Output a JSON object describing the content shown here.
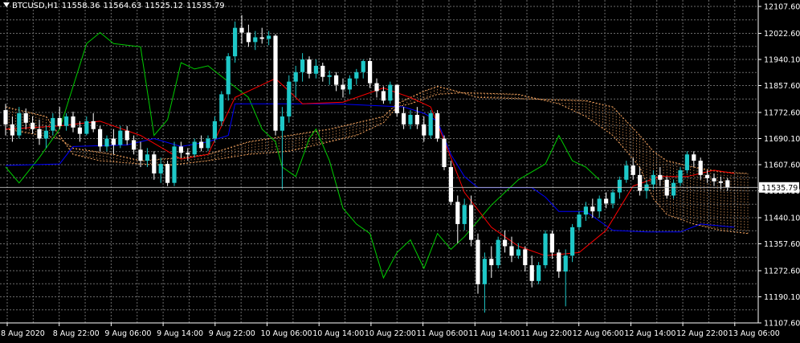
{
  "header": {
    "symbol": "BTCUSD,H1",
    "open": "11558.36",
    "high": "11564.63",
    "low": "11525.12",
    "close": "11535.79"
  },
  "price_label": "11535.79",
  "colors": {
    "background": "#000000",
    "grid": "#6b6b6b",
    "axis_text": "#ffffff",
    "bull": "#1ec8c8",
    "bear": "#ffffff",
    "tenkan": "#ff0000",
    "kijun": "#0000ff",
    "chikou": "#00cc00",
    "cloud": "#f4a460",
    "price_box": "#ffffff"
  },
  "chart_data": {
    "type": "candlestick",
    "instrument": "BTCUSD",
    "timeframe": "H1",
    "ylim": [
      11107.6,
      12107.6
    ],
    "y_ticks": [
      "12107.60",
      "12022.60",
      "11940.10",
      "11857.60",
      "11772.60",
      "11690.10",
      "11607.60",
      "11525.10",
      "11440.10",
      "11357.60",
      "11272.60",
      "11190.10",
      "11107.60"
    ],
    "x_ticks": [
      "8 Aug 2020",
      "8 Aug 22:00",
      "9 Aug 06:00",
      "9 Aug 14:00",
      "9 Aug 22:00",
      "10 Aug 06:00",
      "10 Aug 14:00",
      "10 Aug 22:00",
      "11 Aug 06:00",
      "11 Aug 14:00",
      "11 Aug 22:00",
      "12 Aug 06:00",
      "12 Aug 14:00",
      "12 Aug 22:00",
      "13 Aug 06:00"
    ],
    "grid": true,
    "candles": [
      [
        11780,
        11800,
        11700,
        11735
      ],
      [
        11735,
        11760,
        11680,
        11700
      ],
      [
        11700,
        11790,
        11690,
        11770
      ],
      [
        11770,
        11785,
        11720,
        11740
      ],
      [
        11740,
        11760,
        11705,
        11720
      ],
      [
        11720,
        11750,
        11670,
        11690
      ],
      [
        11690,
        11730,
        11660,
        11715
      ],
      [
        11715,
        11770,
        11700,
        11755
      ],
      [
        11755,
        11790,
        11720,
        11730
      ],
      [
        11730,
        11770,
        11715,
        11760
      ],
      [
        11760,
        11775,
        11710,
        11725
      ],
      [
        11725,
        11745,
        11680,
        11705
      ],
      [
        11705,
        11760,
        11700,
        11745
      ],
      [
        11745,
        11770,
        11710,
        11720
      ],
      [
        11720,
        11730,
        11650,
        11665
      ],
      [
        11665,
        11700,
        11650,
        11690
      ],
      [
        11690,
        11720,
        11640,
        11670
      ],
      [
        11670,
        11730,
        11660,
        11715
      ],
      [
        11715,
        11730,
        11670,
        11685
      ],
      [
        11685,
        11700,
        11640,
        11655
      ],
      [
        11655,
        11680,
        11600,
        11620
      ],
      [
        11620,
        11660,
        11600,
        11640
      ],
      [
        11640,
        11650,
        11560,
        11580
      ],
      [
        11580,
        11630,
        11550,
        11610
      ],
      [
        11610,
        11620,
        11540,
        11550
      ],
      [
        11550,
        11680,
        11540,
        11665
      ],
      [
        11665,
        11680,
        11630,
        11645
      ],
      [
        11645,
        11660,
        11620,
        11640
      ],
      [
        11640,
        11690,
        11630,
        11680
      ],
      [
        11680,
        11700,
        11650,
        11660
      ],
      [
        11660,
        11700,
        11650,
        11690
      ],
      [
        11690,
        11760,
        11680,
        11745
      ],
      [
        11745,
        11840,
        11730,
        11830
      ],
      [
        11830,
        11960,
        11810,
        11950
      ],
      [
        11950,
        12060,
        11930,
        12040
      ],
      [
        12040,
        12080,
        11990,
        12025
      ],
      [
        12025,
        12050,
        11980,
        11995
      ],
      [
        11995,
        12030,
        11970,
        12010
      ],
      [
        12010,
        12040,
        11990,
        12005
      ],
      [
        12005,
        12030,
        11985,
        12015
      ],
      [
        12015,
        12020,
        11700,
        11715
      ],
      [
        11715,
        11790,
        11530,
        11760
      ],
      [
        11760,
        11890,
        11740,
        11870
      ],
      [
        11870,
        11920,
        11820,
        11900
      ],
      [
        11900,
        11960,
        11870,
        11940
      ],
      [
        11940,
        11950,
        11880,
        11895
      ],
      [
        11895,
        11940,
        11880,
        11920
      ],
      [
        11920,
        11930,
        11870,
        11885
      ],
      [
        11885,
        11905,
        11860,
        11890
      ],
      [
        11890,
        11900,
        11840,
        11860
      ],
      [
        11860,
        11880,
        11820,
        11845
      ],
      [
        11845,
        11890,
        11830,
        11880
      ],
      [
        11880,
        11910,
        11860,
        11900
      ],
      [
        11900,
        11940,
        11880,
        11935
      ],
      [
        11935,
        11945,
        11850,
        11865
      ],
      [
        11865,
        11880,
        11820,
        11840
      ],
      [
        11840,
        11855,
        11800,
        11810
      ],
      [
        11810,
        11870,
        11800,
        11860
      ],
      [
        11860,
        11860,
        11760,
        11770
      ],
      [
        11770,
        11790,
        11720,
        11735
      ],
      [
        11735,
        11780,
        11720,
        11765
      ],
      [
        11765,
        11790,
        11720,
        11735
      ],
      [
        11735,
        11760,
        11680,
        11700
      ],
      [
        11700,
        11780,
        11690,
        11770
      ],
      [
        11770,
        11780,
        11680,
        11690
      ],
      [
        11690,
        11700,
        11590,
        11600
      ],
      [
        11600,
        11620,
        11480,
        11490
      ],
      [
        11490,
        11510,
        11360,
        11420
      ],
      [
        11420,
        11500,
        11400,
        11480
      ],
      [
        11480,
        11510,
        11350,
        11370
      ],
      [
        11370,
        11390,
        11200,
        11230
      ],
      [
        11230,
        11330,
        11140,
        11310
      ],
      [
        11310,
        11350,
        11250,
        11290
      ],
      [
        11290,
        11380,
        11280,
        11370
      ],
      [
        11370,
        11400,
        11330,
        11350
      ],
      [
        11350,
        11380,
        11300,
        11320
      ],
      [
        11320,
        11360,
        11310,
        11340
      ],
      [
        11340,
        11350,
        11270,
        11290
      ],
      [
        11290,
        11320,
        11220,
        11240
      ],
      [
        11240,
        11300,
        11230,
        11290
      ],
      [
        11290,
        11400,
        11280,
        11390
      ],
      [
        11390,
        11400,
        11310,
        11330
      ],
      [
        11330,
        11340,
        11250,
        11270
      ],
      [
        11270,
        11340,
        11160,
        11320
      ],
      [
        11320,
        11420,
        11300,
        11410
      ],
      [
        11410,
        11460,
        11400,
        11450
      ],
      [
        11450,
        11490,
        11430,
        11475
      ],
      [
        11475,
        11500,
        11440,
        11460
      ],
      [
        11460,
        11510,
        11440,
        11500
      ],
      [
        11500,
        11520,
        11470,
        11485
      ],
      [
        11485,
        11530,
        11470,
        11520
      ],
      [
        11520,
        11570,
        11500,
        11560
      ],
      [
        11560,
        11620,
        11550,
        11605
      ],
      [
        11605,
        11630,
        11560,
        11575
      ],
      [
        11575,
        11600,
        11510,
        11525
      ],
      [
        11525,
        11560,
        11500,
        11545
      ],
      [
        11545,
        11590,
        11530,
        11575
      ],
      [
        11575,
        11600,
        11540,
        11560
      ],
      [
        11560,
        11570,
        11500,
        11510
      ],
      [
        11510,
        11560,
        11500,
        11550
      ],
      [
        11550,
        11600,
        11540,
        11590
      ],
      [
        11590,
        11650,
        11580,
        11640
      ],
      [
        11640,
        11650,
        11600,
        11620
      ],
      [
        11620,
        11630,
        11560,
        11575
      ],
      [
        11575,
        11590,
        11550,
        11565
      ],
      [
        11565,
        11580,
        11540,
        11555
      ],
      [
        11555,
        11570,
        11530,
        11550
      ],
      [
        11558.36,
        11564.63,
        11525.12,
        11535.79
      ]
    ],
    "tenkan": [
      [
        0,
        11720
      ],
      [
        8,
        11730
      ],
      [
        14,
        11745
      ],
      [
        20,
        11700
      ],
      [
        26,
        11625
      ],
      [
        30,
        11640
      ],
      [
        34,
        11820
      ],
      [
        38,
        11860
      ],
      [
        40,
        11880
      ],
      [
        44,
        11800
      ],
      [
        50,
        11805
      ],
      [
        56,
        11850
      ],
      [
        60,
        11820
      ],
      [
        63,
        11790
      ],
      [
        66,
        11630
      ],
      [
        68,
        11520
      ],
      [
        72,
        11410
      ],
      [
        76,
        11350
      ],
      [
        80,
        11320
      ],
      [
        85,
        11330
      ],
      [
        89,
        11400
      ],
      [
        93,
        11540
      ],
      [
        97,
        11570
      ],
      [
        101,
        11570
      ],
      [
        105,
        11590
      ],
      [
        108,
        11580
      ]
    ],
    "kijun": [
      [
        0,
        11605
      ],
      [
        8,
        11610
      ],
      [
        10,
        11665
      ],
      [
        18,
        11670
      ],
      [
        22,
        11690
      ],
      [
        26,
        11665
      ],
      [
        30,
        11680
      ],
      [
        33,
        11700
      ],
      [
        34,
        11800
      ],
      [
        49,
        11800
      ],
      [
        59,
        11790
      ],
      [
        62,
        11770
      ],
      [
        64,
        11745
      ],
      [
        66,
        11640
      ],
      [
        68,
        11570
      ],
      [
        70,
        11535
      ],
      [
        78,
        11535
      ],
      [
        80,
        11505
      ],
      [
        82,
        11460
      ],
      [
        86,
        11460
      ],
      [
        90,
        11400
      ],
      [
        95,
        11395
      ],
      [
        100,
        11395
      ],
      [
        103,
        11420
      ],
      [
        108,
        11410
      ]
    ],
    "chikou": [
      [
        0,
        11600
      ],
      [
        2,
        11550
      ],
      [
        5,
        11630
      ],
      [
        8,
        11720
      ],
      [
        12,
        11990
      ],
      [
        14,
        12025
      ],
      [
        16,
        11990
      ],
      [
        20,
        11980
      ],
      [
        22,
        11700
      ],
      [
        24,
        11750
      ],
      [
        26,
        11930
      ],
      [
        28,
        11910
      ],
      [
        30,
        11920
      ],
      [
        33,
        11870
      ],
      [
        36,
        11820
      ],
      [
        38,
        11720
      ],
      [
        40,
        11680
      ],
      [
        41,
        11600
      ],
      [
        43,
        11570
      ],
      [
        45,
        11690
      ],
      [
        46,
        11720
      ],
      [
        48,
        11620
      ],
      [
        50,
        11470
      ],
      [
        52,
        11420
      ],
      [
        54,
        11390
      ],
      [
        56,
        11250
      ],
      [
        58,
        11330
      ],
      [
        60,
        11370
      ],
      [
        62,
        11280
      ],
      [
        64,
        11390
      ],
      [
        66,
        11340
      ],
      [
        68,
        11380
      ],
      [
        72,
        11480
      ],
      [
        76,
        11560
      ],
      [
        80,
        11610
      ],
      [
        82,
        11700
      ],
      [
        84,
        11620
      ],
      [
        86,
        11600
      ],
      [
        88,
        11560
      ]
    ],
    "senkou_a": [
      [
        0,
        11720
      ],
      [
        8,
        11690
      ],
      [
        10,
        11660
      ],
      [
        16,
        11640
      ],
      [
        20,
        11620
      ],
      [
        26,
        11630
      ],
      [
        30,
        11640
      ],
      [
        36,
        11680
      ],
      [
        42,
        11700
      ],
      [
        48,
        11720
      ],
      [
        56,
        11760
      ],
      [
        58,
        11800
      ],
      [
        62,
        11840
      ],
      [
        64,
        11855
      ],
      [
        66,
        11845
      ],
      [
        70,
        11820
      ],
      [
        78,
        11815
      ],
      [
        86,
        11810
      ],
      [
        90,
        11790
      ],
      [
        94,
        11700
      ],
      [
        96,
        11650
      ],
      [
        98,
        11620
      ],
      [
        102,
        11600
      ],
      [
        106,
        11585
      ],
      [
        110,
        11580
      ]
    ],
    "senkou_b": [
      [
        0,
        11790
      ],
      [
        6,
        11760
      ],
      [
        10,
        11640
      ],
      [
        14,
        11620
      ],
      [
        20,
        11610
      ],
      [
        24,
        11605
      ],
      [
        30,
        11620
      ],
      [
        36,
        11640
      ],
      [
        42,
        11650
      ],
      [
        48,
        11680
      ],
      [
        52,
        11700
      ],
      [
        56,
        11740
      ],
      [
        58,
        11790
      ],
      [
        60,
        11800
      ],
      [
        64,
        11830
      ],
      [
        68,
        11835
      ],
      [
        76,
        11830
      ],
      [
        82,
        11800
      ],
      [
        86,
        11760
      ],
      [
        90,
        11700
      ],
      [
        94,
        11600
      ],
      [
        96,
        11500
      ],
      [
        98,
        11450
      ],
      [
        102,
        11420
      ],
      [
        106,
        11400
      ],
      [
        110,
        11390
      ]
    ]
  }
}
